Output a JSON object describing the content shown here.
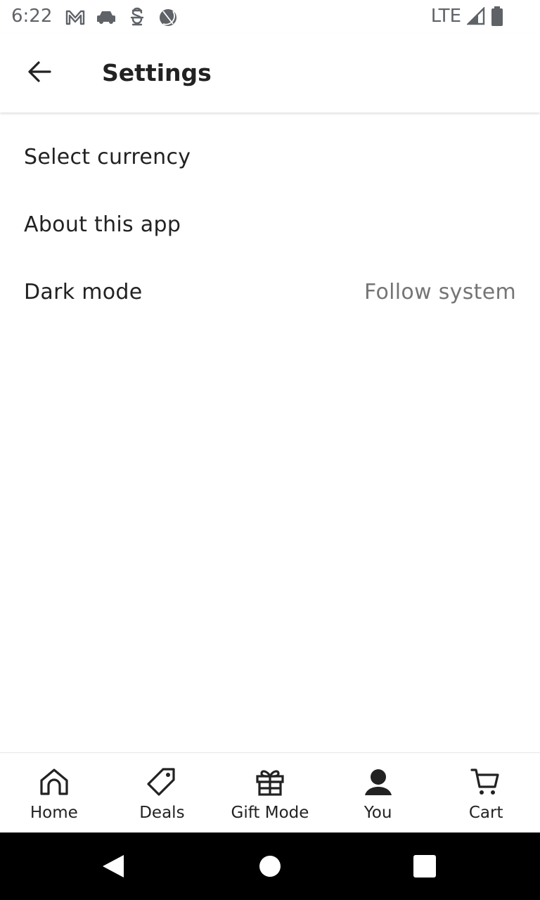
{
  "status_bar": {
    "time": "6:22",
    "network": "LTE",
    "notification_icons": [
      "gmail-icon",
      "car-icon",
      "app-icon",
      "basketball-icon"
    ]
  },
  "header": {
    "title": "Settings",
    "back_icon": "arrow-left-icon"
  },
  "settings": [
    {
      "label": "Select currency",
      "value": ""
    },
    {
      "label": "About this app",
      "value": ""
    },
    {
      "label": "Dark mode",
      "value": "Follow system"
    }
  ],
  "bottom_nav": [
    {
      "label": "Home",
      "icon": "home-icon"
    },
    {
      "label": "Deals",
      "icon": "tag-icon"
    },
    {
      "label": "Gift Mode",
      "icon": "gift-icon"
    },
    {
      "label": "You",
      "icon": "person-icon"
    },
    {
      "label": "Cart",
      "icon": "cart-icon"
    }
  ],
  "colors": {
    "text_primary": "#222222",
    "text_secondary": "#757575",
    "system_nav_bg": "#000000"
  }
}
